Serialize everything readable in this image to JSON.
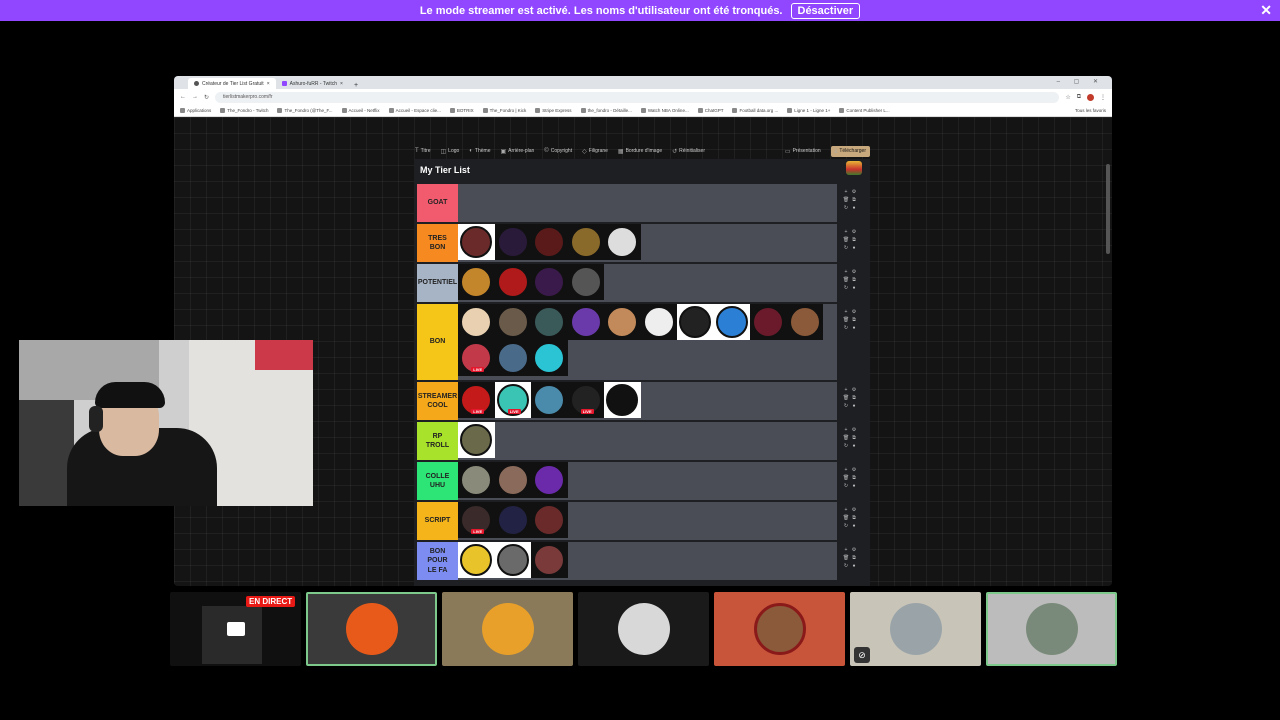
{
  "banner": {
    "text": "Le mode streamer est activé. Les noms d'utilisateur ont été tronqués.",
    "button": "Désactiver",
    "close": "✕"
  },
  "browser": {
    "tabs": [
      {
        "label": "Créateur de Tier List Gratuit"
      },
      {
        "label": "Ashuro-fuRR - Twitch"
      }
    ],
    "new_tab": "+",
    "url": "tierlistmakerpro.com/fr",
    "bookmarks": [
      "Applications",
      "The_Fondro - Twitch",
      "The_Fondro (@The_F...",
      "Accueil - Netflix",
      "Accueil - Espace clie...",
      "BOTRIX",
      "The_Fondro | Kick",
      "Stripe Express",
      "the_fondro - Détaille...",
      "Watch NBA Online...",
      "ChatGPT",
      "Football data.org ...",
      "Ligne 1 - Ligne 1+",
      "Content Publisher L..."
    ],
    "bookmarks_right": "Tous les favoris"
  },
  "toolbar": {
    "items": [
      "Titre",
      "Logo",
      "Thème",
      "Arrière-plan",
      "Copyright",
      "Filigrane",
      "Bordure d'image",
      "Réinitialiser"
    ],
    "presentation": "Présentation",
    "download": "Télécharger"
  },
  "tierlist": {
    "title": "My Tier List",
    "tiers": [
      {
        "label": "GOAT",
        "color": "#f25b6e",
        "height": 38,
        "items": []
      },
      {
        "label": "TRES\nBON",
        "color": "#f6891f",
        "height": 38,
        "items": [
          "#6b2a2a",
          "#2a1a3a",
          "#5a1a1a",
          "#8a6a2a",
          "#dddddd"
        ],
        "boxes": [
          true,
          false,
          false,
          false,
          false
        ]
      },
      {
        "label": "POTENTIEL",
        "color": "#a7b4c6",
        "height": 38,
        "items": [
          "#c4862a",
          "#b01a1a",
          "#3a1a4a",
          "#555555"
        ]
      },
      {
        "label": "BON",
        "color": "#f5c518",
        "height": 76,
        "items": [
          "#e8d0b0",
          "#6a5a4a",
          "#3a5a5a",
          "#6a3aaa",
          "#c28a5a",
          "#eeeeee",
          "#222222",
          "#2b7fd4",
          "#6a1a2a",
          "#8a5a3a",
          "#c23a4a",
          "#4a6a8a",
          "#2ac4d4"
        ],
        "live": [
          false,
          false,
          false,
          false,
          false,
          false,
          false,
          false,
          false,
          false,
          true,
          false,
          false
        ],
        "boxes": [
          false,
          false,
          false,
          false,
          false,
          false,
          true,
          true,
          false,
          false,
          false,
          false,
          false
        ]
      },
      {
        "label": "STREAMER\nCOOL",
        "color": "#f5a81a",
        "height": 38,
        "items": [
          "#c41a1a",
          "#3ac4b4",
          "#4a8aaa",
          "#222222",
          "#111111"
        ],
        "live": [
          true,
          true,
          false,
          true,
          false
        ],
        "boxes": [
          false,
          true,
          false,
          false,
          true
        ]
      },
      {
        "label": "RP\nTROLL",
        "color": "#a8e22a",
        "height": 38,
        "items": [
          "#6a6a4a"
        ],
        "boxes": [
          true
        ]
      },
      {
        "label": "COLLE\nUHU",
        "color": "#2ce576",
        "height": 38,
        "items": [
          "#8a8a7a",
          "#8a6a5a",
          "#6a2aaa"
        ]
      },
      {
        "label": "SCRIPT",
        "color": "#f5b41a",
        "height": 38,
        "items": [
          "#3a2a2a",
          "#222244",
          "#6a2a2a"
        ],
        "live": [
          true,
          false,
          false
        ]
      },
      {
        "label": "BON\nPOUR\nLE FA",
        "color": "#7c8cf0",
        "height": 38,
        "items": [
          "#e8c42a",
          "#6a6a6a",
          "#7a3a3a"
        ],
        "boxes": [
          true,
          true,
          false
        ]
      }
    ],
    "live_label": "LIVE"
  },
  "tiles": {
    "live_badge": "EN DIRECT"
  }
}
